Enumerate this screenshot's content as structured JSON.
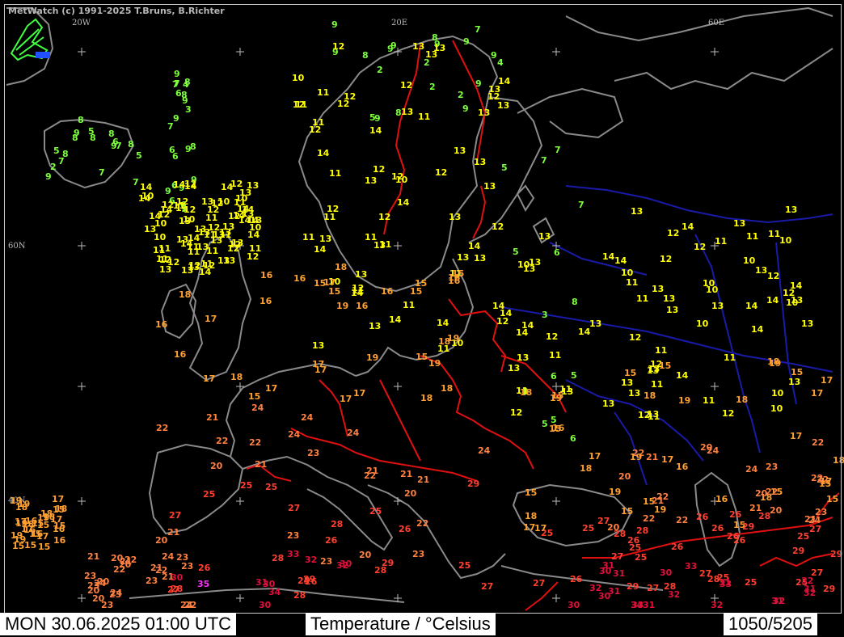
{
  "app": {
    "credit": "MetWatch  (c) 1991-2025 T.Bruns, B.Richter"
  },
  "footer": {
    "datetime": "MON 30.06.2025 01:00 UTC",
    "parameter": "Temperature / °Celsius",
    "counter": "1050/5205"
  },
  "grid_labels": {
    "lon20w": "20W",
    "lon20e": "20E",
    "lon60e": "60E",
    "lat60n": "60N",
    "lat40n": "40N"
  },
  "colors": {
    "background": "#000000",
    "coast": "#8a8a8a",
    "border": "#e01010",
    "river": "#1a1aa8",
    "t_le9": "#7cff3c",
    "t_10_14": "#ffff00",
    "t_15_19": "#ffa030",
    "t_20_24": "#ff8040",
    "t_25_29": "#ff4030",
    "t_30_34": "#e0103a",
    "t_ge35": "#ff30ff"
  },
  "temperatures": [
    3,
    2,
    4,
    2,
    5,
    6,
    5,
    4,
    5,
    6,
    9,
    2,
    5,
    6,
    2,
    7,
    7,
    6,
    3,
    5,
    7,
    8,
    5,
    7,
    5,
    9,
    6,
    10,
    7,
    6,
    7,
    9,
    10,
    9,
    11,
    9,
    8,
    8,
    7,
    6,
    5,
    7,
    12,
    13,
    11,
    8,
    7,
    6,
    5,
    11,
    12,
    11,
    12,
    10,
    7,
    7,
    6,
    10,
    11,
    9,
    10,
    8,
    6,
    13,
    12,
    11,
    9,
    8,
    9,
    10,
    11,
    9,
    9,
    10,
    13,
    12,
    8,
    11,
    11,
    8,
    9,
    12,
    11,
    12,
    11,
    10,
    8,
    9,
    13,
    12,
    11,
    12,
    10,
    11,
    8,
    10,
    13,
    9,
    11,
    12,
    13,
    10,
    11,
    13,
    12,
    8,
    9,
    11,
    10,
    12,
    11,
    12,
    13,
    11,
    9,
    13,
    11,
    13,
    11,
    8,
    13,
    12,
    13,
    10,
    12,
    13,
    12,
    11,
    13,
    11,
    10,
    12,
    9,
    10,
    13,
    11,
    12,
    11,
    10,
    12,
    11,
    12,
    13,
    9,
    10,
    13,
    11,
    13,
    10,
    12,
    11,
    12,
    13,
    9,
    8,
    13,
    12,
    13,
    11,
    12,
    14,
    11,
    12,
    13,
    14,
    12,
    11,
    13,
    10,
    9,
    10,
    13,
    14,
    12,
    13,
    14,
    12,
    13,
    14,
    13,
    11,
    13,
    12,
    13,
    14,
    12,
    13,
    14,
    13,
    15,
    13,
    14,
    15,
    13,
    12,
    14,
    13,
    13,
    14,
    14,
    12,
    13,
    14,
    12,
    13,
    14,
    13,
    12,
    11,
    13,
    13,
    13,
    13,
    13,
    11,
    13,
    14,
    12,
    13,
    14,
    12,
    11,
    14,
    11,
    13,
    14,
    13,
    13,
    14,
    11,
    15,
    14,
    13,
    13,
    11,
    14,
    13,
    15,
    12,
    13,
    14,
    15,
    13,
    15,
    14,
    15,
    14,
    13,
    14,
    13,
    14,
    14,
    15,
    12,
    11,
    14,
    15,
    15,
    16,
    15,
    14,
    15,
    16,
    14,
    15,
    16,
    15,
    16,
    15,
    14,
    15,
    16,
    17,
    15,
    16,
    15,
    16,
    17,
    18,
    15,
    16,
    17,
    16,
    18,
    17,
    16,
    17,
    18,
    19,
    17,
    18,
    16,
    17,
    19,
    18,
    17,
    18,
    19,
    17,
    18,
    16,
    17,
    19,
    18,
    17,
    18,
    19,
    20,
    18,
    19,
    17,
    18,
    19,
    20,
    19,
    18,
    20,
    21,
    19,
    20,
    21,
    22,
    20,
    21,
    20,
    19,
    21,
    22,
    20,
    21,
    22,
    23,
    21,
    22,
    23,
    22,
    21,
    23,
    24,
    22,
    23,
    24,
    22,
    23,
    25,
    24,
    23,
    22,
    24,
    25,
    23,
    22,
    21,
    25,
    26,
    24,
    25,
    26,
    25,
    24,
    26,
    25,
    27,
    26,
    25,
    27,
    26,
    28,
    27,
    26,
    28,
    27,
    26,
    25,
    29,
    28,
    27,
    29,
    28,
    30,
    29,
    28,
    27,
    30,
    29,
    31,
    30,
    32,
    31,
    30,
    33,
    32,
    31,
    33,
    32,
    34,
    33,
    32,
    31,
    35,
    10,
    9,
    8,
    12,
    13,
    14,
    15,
    16,
    17,
    18,
    13,
    14,
    12,
    11,
    13,
    14,
    15,
    13,
    12,
    14,
    13,
    15,
    16,
    17,
    18,
    19,
    20,
    21,
    22,
    23,
    24,
    25,
    14,
    15,
    16,
    17,
    18,
    20,
    21,
    22,
    23,
    24,
    25,
    26,
    27,
    28,
    13,
    15,
    17,
    19,
    20,
    21,
    22,
    23,
    24,
    25,
    26,
    27,
    28,
    29,
    30,
    31,
    32,
    12,
    11,
    13,
    14,
    17,
    16,
    15,
    18,
    17,
    19,
    20,
    22,
    21,
    23,
    24,
    25,
    26,
    27,
    28,
    29,
    30,
    31,
    32,
    33,
    34,
    22,
    20,
    18,
    17,
    19,
    21,
    23,
    22,
    24,
    25,
    27,
    29,
    26,
    28,
    30,
    31,
    32,
    13,
    14,
    15,
    16,
    17,
    18,
    19,
    20,
    21,
    22,
    9,
    2,
    12,
    13,
    14,
    15,
    17,
    18,
    19,
    20,
    22,
    23,
    24,
    25,
    26,
    27,
    28,
    29,
    30,
    31,
    32
  ]
}
